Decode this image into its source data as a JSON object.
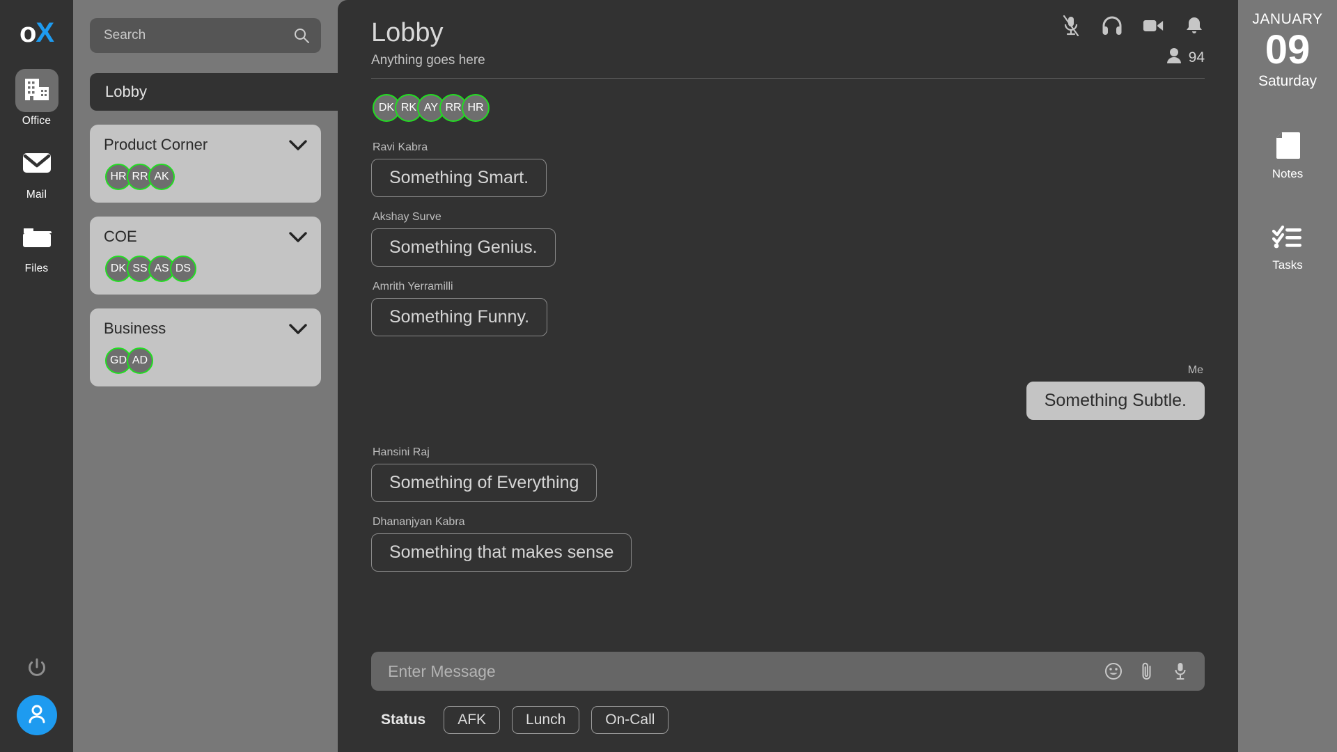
{
  "brand": {
    "logo_o": "o",
    "logo_x": "X",
    "accent_color": "#1e9bf0"
  },
  "rail": {
    "items": [
      {
        "label": "Office",
        "icon": "office-building-icon",
        "active": true
      },
      {
        "label": "Mail",
        "icon": "envelope-icon",
        "active": false
      },
      {
        "label": "Files",
        "icon": "folder-icon",
        "active": false
      }
    ],
    "power_icon": "power-icon",
    "avatar_icon": "user-avatar-icon"
  },
  "search": {
    "placeholder": "Search",
    "value": "",
    "icon": "search-icon"
  },
  "channels": {
    "active_channel": "Lobby",
    "groups": [
      {
        "name": "Product Corner",
        "chevron": "chevron-down-icon",
        "members": [
          "HR",
          "RR",
          "AK"
        ]
      },
      {
        "name": "COE",
        "chevron": "chevron-down-icon",
        "members": [
          "DK",
          "SS",
          "AS",
          "DS"
        ]
      },
      {
        "name": "Business",
        "chevron": "chevron-down-icon",
        "members": [
          "GD",
          "AD"
        ]
      }
    ],
    "presence_ring_color": "#22dd22"
  },
  "chat": {
    "title": "Lobby",
    "subtitle": "Anything goes here",
    "header_icons": [
      {
        "name": "microphone-muted-icon"
      },
      {
        "name": "headphones-icon"
      },
      {
        "name": "video-camera-icon"
      },
      {
        "name": "bell-icon"
      }
    ],
    "member_count": "94",
    "member_icon": "person-icon",
    "presence_avatars": [
      "DK",
      "RK",
      "AY",
      "RR",
      "HR"
    ],
    "messages": [
      {
        "author": "Ravi Kabra",
        "text": "Something Smart.",
        "mine": false
      },
      {
        "author": "Akshay Surve",
        "text": "Something Genius.",
        "mine": false
      },
      {
        "author": "Amrith Yerramilli",
        "text": "Something Funny.",
        "mine": false
      },
      {
        "author": "Me",
        "text": "Something Subtle.",
        "mine": true
      },
      {
        "author": "Hansini Raj",
        "text": "Something of Everything",
        "mine": false
      },
      {
        "author": "Dhananjyan Kabra",
        "text": "Something that makes sense",
        "mine": false
      }
    ],
    "composer": {
      "placeholder": "Enter Message",
      "value": "",
      "icons": [
        {
          "name": "emoji-smiley-icon"
        },
        {
          "name": "paperclip-attachment-icon"
        },
        {
          "name": "microphone-icon"
        }
      ]
    },
    "status": {
      "label": "Status",
      "options": [
        "AFK",
        "Lunch",
        "On-Call"
      ]
    }
  },
  "right_rail": {
    "date": {
      "month": "JANUARY",
      "day": "09",
      "weekday": "Saturday"
    },
    "items": [
      {
        "label": "Notes",
        "icon": "note-page-icon"
      },
      {
        "label": "Tasks",
        "icon": "checklist-icon"
      }
    ]
  }
}
